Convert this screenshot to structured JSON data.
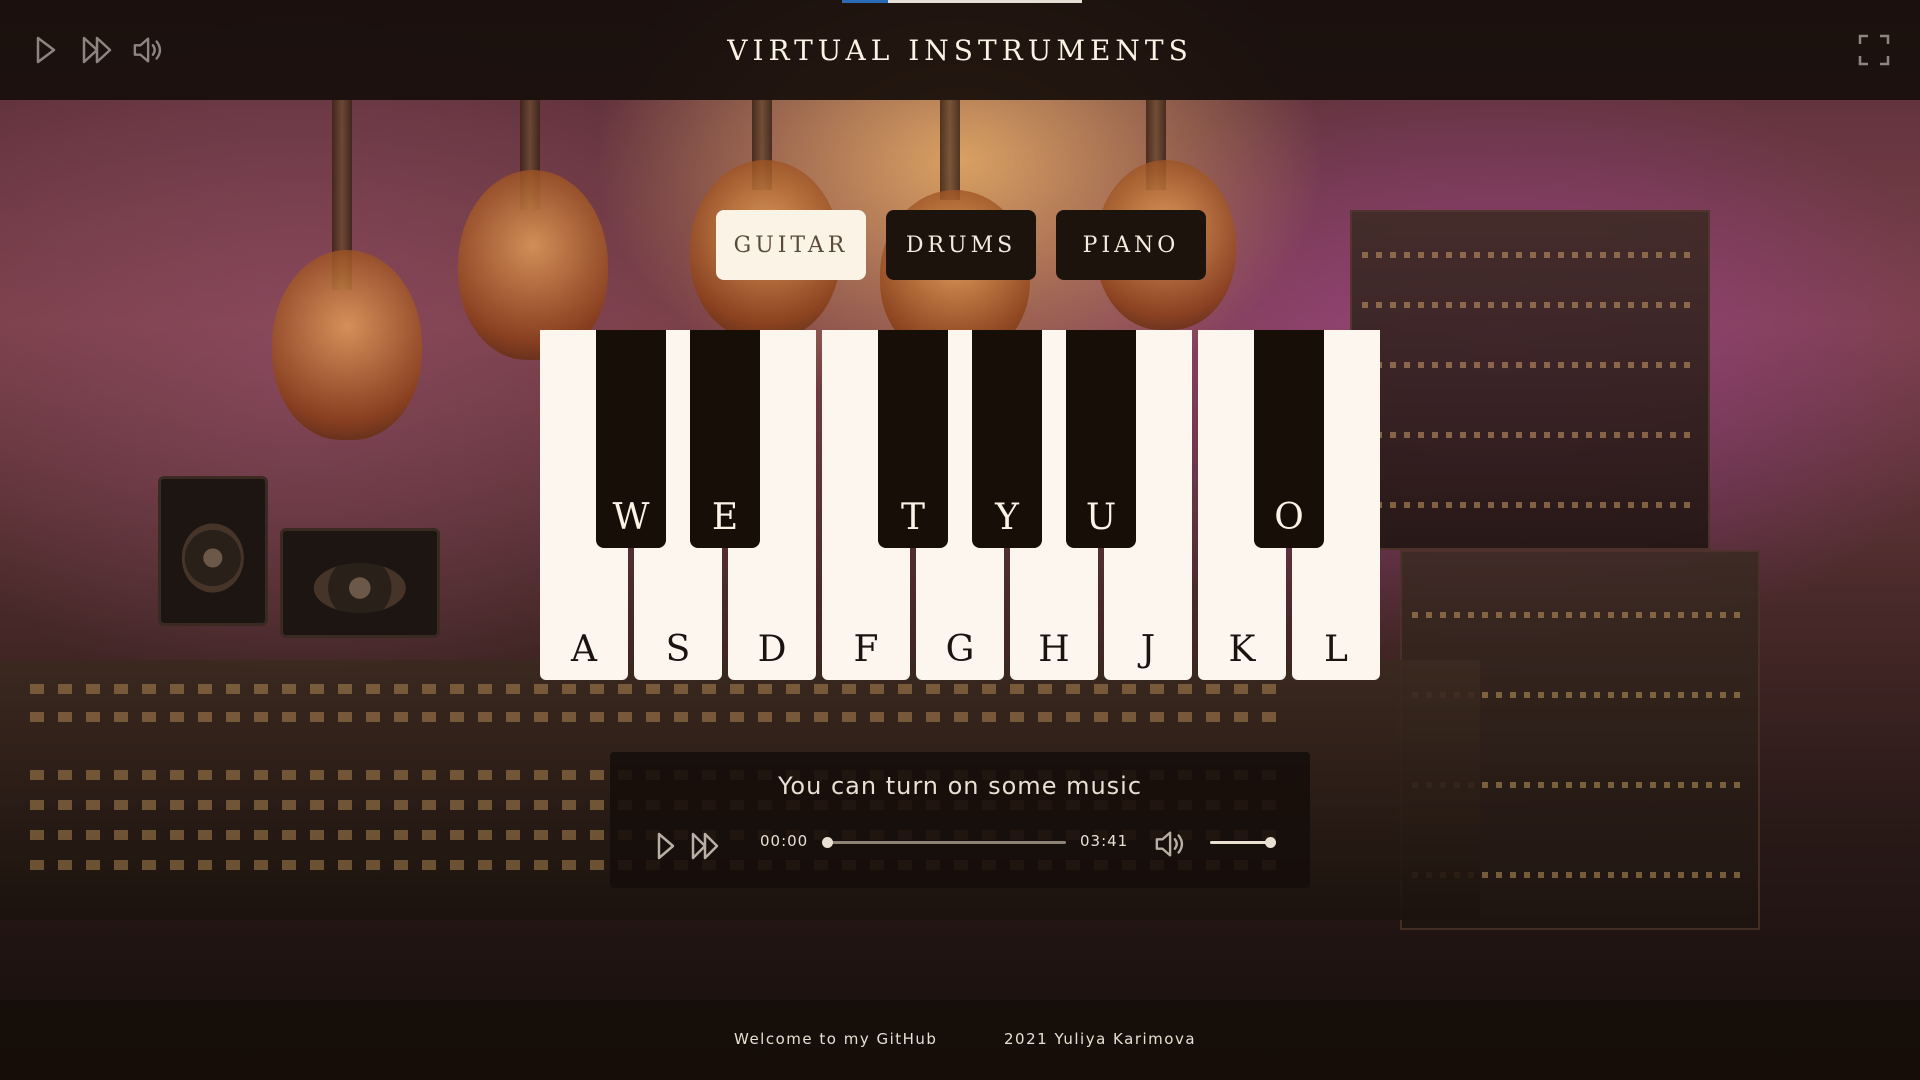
{
  "header": {
    "title": "VIRTUAL INSTRUMENTS",
    "icons": [
      "play-icon",
      "fast-forward-icon",
      "volume-icon",
      "fullscreen-icon"
    ]
  },
  "tabs": [
    {
      "label": "GUITAR",
      "active": true
    },
    {
      "label": "DRUMS",
      "active": false
    },
    {
      "label": "PIANO",
      "active": false
    }
  ],
  "piano": {
    "white_keys": [
      "A",
      "S",
      "D",
      "F",
      "G",
      "H",
      "J",
      "K",
      "L"
    ],
    "black_keys": [
      "W",
      "E",
      "T",
      "Y",
      "U",
      "O"
    ]
  },
  "player": {
    "message": "You can turn on some music",
    "current_time": "00:00",
    "duration": "03:41",
    "progress": 0,
    "volume": 0.9
  },
  "footer": {
    "link_text": "Welcome to my GitHub",
    "copyright": "2021 Yuliya Karimova"
  },
  "colors": {
    "key_white": "#fcf6ee",
    "key_black": "#170e07",
    "tab_active_bg": "#fbf3e6",
    "panel_bg": "#160e0a"
  }
}
